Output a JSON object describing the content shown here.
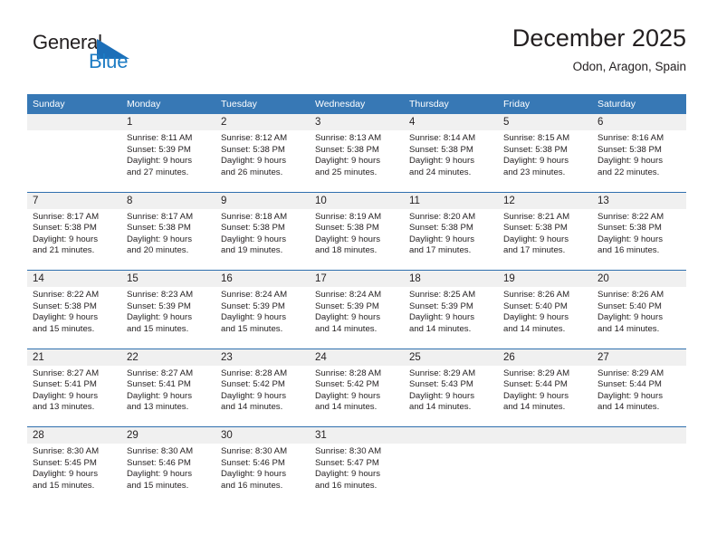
{
  "brand": {
    "name_part1": "General",
    "name_part2": "Blue",
    "triangle_color": "#1d6fb8",
    "text_color": "#231f20",
    "blue_color": "#1d7cc4"
  },
  "header": {
    "title": "December 2025",
    "location": "Odon, Aragon, Spain"
  },
  "theme": {
    "header_bg": "#3778b5",
    "daynum_bg": "#f0f0f0",
    "separator": "#2f6fae",
    "text": "#231f20"
  },
  "weekdays": [
    "Sunday",
    "Monday",
    "Tuesday",
    "Wednesday",
    "Thursday",
    "Friday",
    "Saturday"
  ],
  "weeks": [
    {
      "days": [
        {
          "num": "",
          "sunrise": "",
          "sunset": "",
          "daylight1": "",
          "daylight2": ""
        },
        {
          "num": "1",
          "sunrise": "Sunrise: 8:11 AM",
          "sunset": "Sunset: 5:39 PM",
          "daylight1": "Daylight: 9 hours",
          "daylight2": "and 27 minutes."
        },
        {
          "num": "2",
          "sunrise": "Sunrise: 8:12 AM",
          "sunset": "Sunset: 5:38 PM",
          "daylight1": "Daylight: 9 hours",
          "daylight2": "and 26 minutes."
        },
        {
          "num": "3",
          "sunrise": "Sunrise: 8:13 AM",
          "sunset": "Sunset: 5:38 PM",
          "daylight1": "Daylight: 9 hours",
          "daylight2": "and 25 minutes."
        },
        {
          "num": "4",
          "sunrise": "Sunrise: 8:14 AM",
          "sunset": "Sunset: 5:38 PM",
          "daylight1": "Daylight: 9 hours",
          "daylight2": "and 24 minutes."
        },
        {
          "num": "5",
          "sunrise": "Sunrise: 8:15 AM",
          "sunset": "Sunset: 5:38 PM",
          "daylight1": "Daylight: 9 hours",
          "daylight2": "and 23 minutes."
        },
        {
          "num": "6",
          "sunrise": "Sunrise: 8:16 AM",
          "sunset": "Sunset: 5:38 PM",
          "daylight1": "Daylight: 9 hours",
          "daylight2": "and 22 minutes."
        }
      ]
    },
    {
      "days": [
        {
          "num": "7",
          "sunrise": "Sunrise: 8:17 AM",
          "sunset": "Sunset: 5:38 PM",
          "daylight1": "Daylight: 9 hours",
          "daylight2": "and 21 minutes."
        },
        {
          "num": "8",
          "sunrise": "Sunrise: 8:17 AM",
          "sunset": "Sunset: 5:38 PM",
          "daylight1": "Daylight: 9 hours",
          "daylight2": "and 20 minutes."
        },
        {
          "num": "9",
          "sunrise": "Sunrise: 8:18 AM",
          "sunset": "Sunset: 5:38 PM",
          "daylight1": "Daylight: 9 hours",
          "daylight2": "and 19 minutes."
        },
        {
          "num": "10",
          "sunrise": "Sunrise: 8:19 AM",
          "sunset": "Sunset: 5:38 PM",
          "daylight1": "Daylight: 9 hours",
          "daylight2": "and 18 minutes."
        },
        {
          "num": "11",
          "sunrise": "Sunrise: 8:20 AM",
          "sunset": "Sunset: 5:38 PM",
          "daylight1": "Daylight: 9 hours",
          "daylight2": "and 17 minutes."
        },
        {
          "num": "12",
          "sunrise": "Sunrise: 8:21 AM",
          "sunset": "Sunset: 5:38 PM",
          "daylight1": "Daylight: 9 hours",
          "daylight2": "and 17 minutes."
        },
        {
          "num": "13",
          "sunrise": "Sunrise: 8:22 AM",
          "sunset": "Sunset: 5:38 PM",
          "daylight1": "Daylight: 9 hours",
          "daylight2": "and 16 minutes."
        }
      ]
    },
    {
      "days": [
        {
          "num": "14",
          "sunrise": "Sunrise: 8:22 AM",
          "sunset": "Sunset: 5:38 PM",
          "daylight1": "Daylight: 9 hours",
          "daylight2": "and 15 minutes."
        },
        {
          "num": "15",
          "sunrise": "Sunrise: 8:23 AM",
          "sunset": "Sunset: 5:39 PM",
          "daylight1": "Daylight: 9 hours",
          "daylight2": "and 15 minutes."
        },
        {
          "num": "16",
          "sunrise": "Sunrise: 8:24 AM",
          "sunset": "Sunset: 5:39 PM",
          "daylight1": "Daylight: 9 hours",
          "daylight2": "and 15 minutes."
        },
        {
          "num": "17",
          "sunrise": "Sunrise: 8:24 AM",
          "sunset": "Sunset: 5:39 PM",
          "daylight1": "Daylight: 9 hours",
          "daylight2": "and 14 minutes."
        },
        {
          "num": "18",
          "sunrise": "Sunrise: 8:25 AM",
          "sunset": "Sunset: 5:39 PM",
          "daylight1": "Daylight: 9 hours",
          "daylight2": "and 14 minutes."
        },
        {
          "num": "19",
          "sunrise": "Sunrise: 8:26 AM",
          "sunset": "Sunset: 5:40 PM",
          "daylight1": "Daylight: 9 hours",
          "daylight2": "and 14 minutes."
        },
        {
          "num": "20",
          "sunrise": "Sunrise: 8:26 AM",
          "sunset": "Sunset: 5:40 PM",
          "daylight1": "Daylight: 9 hours",
          "daylight2": "and 14 minutes."
        }
      ]
    },
    {
      "days": [
        {
          "num": "21",
          "sunrise": "Sunrise: 8:27 AM",
          "sunset": "Sunset: 5:41 PM",
          "daylight1": "Daylight: 9 hours",
          "daylight2": "and 13 minutes."
        },
        {
          "num": "22",
          "sunrise": "Sunrise: 8:27 AM",
          "sunset": "Sunset: 5:41 PM",
          "daylight1": "Daylight: 9 hours",
          "daylight2": "and 13 minutes."
        },
        {
          "num": "23",
          "sunrise": "Sunrise: 8:28 AM",
          "sunset": "Sunset: 5:42 PM",
          "daylight1": "Daylight: 9 hours",
          "daylight2": "and 14 minutes."
        },
        {
          "num": "24",
          "sunrise": "Sunrise: 8:28 AM",
          "sunset": "Sunset: 5:42 PM",
          "daylight1": "Daylight: 9 hours",
          "daylight2": "and 14 minutes."
        },
        {
          "num": "25",
          "sunrise": "Sunrise: 8:29 AM",
          "sunset": "Sunset: 5:43 PM",
          "daylight1": "Daylight: 9 hours",
          "daylight2": "and 14 minutes."
        },
        {
          "num": "26",
          "sunrise": "Sunrise: 8:29 AM",
          "sunset": "Sunset: 5:44 PM",
          "daylight1": "Daylight: 9 hours",
          "daylight2": "and 14 minutes."
        },
        {
          "num": "27",
          "sunrise": "Sunrise: 8:29 AM",
          "sunset": "Sunset: 5:44 PM",
          "daylight1": "Daylight: 9 hours",
          "daylight2": "and 14 minutes."
        }
      ]
    },
    {
      "days": [
        {
          "num": "28",
          "sunrise": "Sunrise: 8:30 AM",
          "sunset": "Sunset: 5:45 PM",
          "daylight1": "Daylight: 9 hours",
          "daylight2": "and 15 minutes."
        },
        {
          "num": "29",
          "sunrise": "Sunrise: 8:30 AM",
          "sunset": "Sunset: 5:46 PM",
          "daylight1": "Daylight: 9 hours",
          "daylight2": "and 15 minutes."
        },
        {
          "num": "30",
          "sunrise": "Sunrise: 8:30 AM",
          "sunset": "Sunset: 5:46 PM",
          "daylight1": "Daylight: 9 hours",
          "daylight2": "and 16 minutes."
        },
        {
          "num": "31",
          "sunrise": "Sunrise: 8:30 AM",
          "sunset": "Sunset: 5:47 PM",
          "daylight1": "Daylight: 9 hours",
          "daylight2": "and 16 minutes."
        },
        {
          "num": "",
          "sunrise": "",
          "sunset": "",
          "daylight1": "",
          "daylight2": ""
        },
        {
          "num": "",
          "sunrise": "",
          "sunset": "",
          "daylight1": "",
          "daylight2": ""
        },
        {
          "num": "",
          "sunrise": "",
          "sunset": "",
          "daylight1": "",
          "daylight2": ""
        }
      ]
    }
  ]
}
